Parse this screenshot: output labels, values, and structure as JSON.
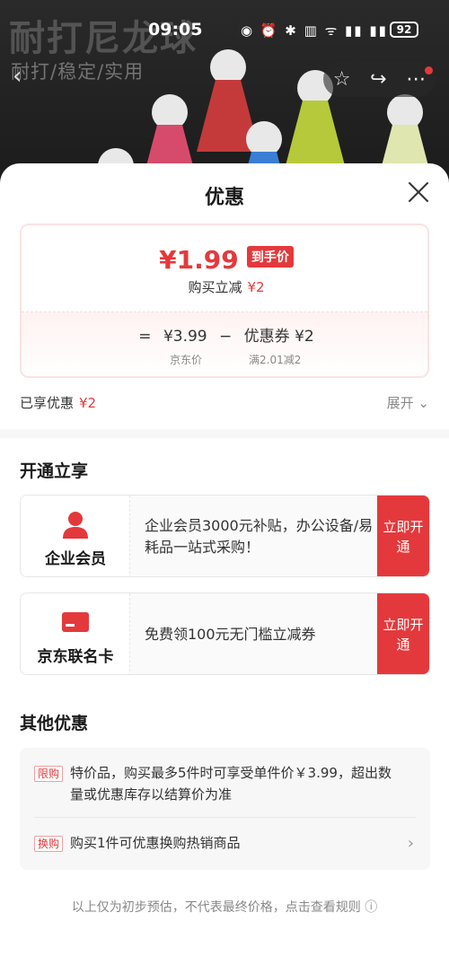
{
  "status": {
    "time": "09:05",
    "battery": "92"
  },
  "product_bg": {
    "title": "耐打尼龙球",
    "subtitle": "耐打/稳定/实用"
  },
  "sheet": {
    "title": "优惠"
  },
  "price": {
    "main": "¥1.99",
    "tag": "到手价",
    "reduce_label": "购买立减",
    "reduce_amount": "¥2",
    "formula": {
      "eq": "=",
      "base": "¥3.99",
      "minus": "−",
      "coupon": "优惠券 ¥2"
    },
    "base_caption": "京东价",
    "coupon_caption": "满2.01减2"
  },
  "enjoyed": {
    "label": "已享优惠",
    "amount": "¥2"
  },
  "expand_label": "展开",
  "open_section": {
    "title": "开通立享",
    "cards": [
      {
        "label": "企业会员",
        "desc": "企业会员3000元补贴，办公设备/易耗品一站式采购！",
        "cta": "立即开通"
      },
      {
        "label": "京东联名卡",
        "desc": "免费领100元无门槛立减券",
        "cta": "立即开通"
      }
    ]
  },
  "other_section": {
    "title": "其他优惠",
    "items": [
      {
        "badge": "限购",
        "text": "特价品，购买最多5件时可享受单件价￥3.99，超出数量或优惠库存以结算价为准"
      },
      {
        "badge": "换购",
        "text": "购买1件可优惠换购热销商品"
      }
    ]
  },
  "footnote": "以上仅为初步预估，不代表最终价格，点击查看规则 ⓘ",
  "colors": {
    "accent": "#e4393c"
  }
}
